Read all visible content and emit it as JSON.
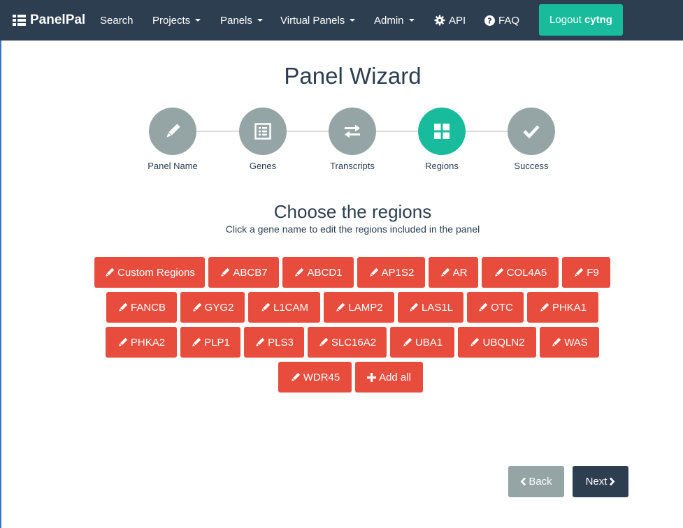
{
  "navbar": {
    "brand": "PanelPal",
    "items": [
      {
        "label": "Search",
        "dropdown": false
      },
      {
        "label": "Projects",
        "dropdown": true
      },
      {
        "label": "Panels",
        "dropdown": true
      },
      {
        "label": "Virtual Panels",
        "dropdown": true
      },
      {
        "label": "Admin",
        "dropdown": true
      },
      {
        "label": "API",
        "icon": "gear-icon"
      },
      {
        "label": "FAQ",
        "icon": "question-circle-icon"
      }
    ],
    "logout_label": "Logout",
    "username": "cytng"
  },
  "wizard": {
    "title": "Panel Wizard",
    "steps": [
      {
        "label": "Panel Name",
        "icon": "pencil-icon",
        "active": false
      },
      {
        "label": "Genes",
        "icon": "list-icon",
        "active": false
      },
      {
        "label": "Transcripts",
        "icon": "swap-arrows-icon",
        "active": false
      },
      {
        "label": "Regions",
        "icon": "grid-icon",
        "active": true
      },
      {
        "label": "Success",
        "icon": "checkmark-icon",
        "active": false
      }
    ]
  },
  "regions": {
    "heading": "Choose the regions",
    "instructions": "Click a gene name to edit the regions included in the panel",
    "buttons": [
      "Custom Regions",
      "ABCB7",
      "ABCD1",
      "AP1S2",
      "AR",
      "COL4A5",
      "F9",
      "FANCB",
      "GYG2",
      "L1CAM",
      "LAMP2",
      "LAS1L",
      "OTC",
      "PHKA1",
      "PHKA2",
      "PLP1",
      "PLS3",
      "SLC16A2",
      "UBA1",
      "UBQLN2",
      "WAS",
      "WDR45"
    ],
    "add_all_label": "Add all"
  },
  "footer": {
    "back_label": "Back",
    "next_label": "Next"
  },
  "colors": {
    "navbar": "#2c3e50",
    "accent": "#18bc9c",
    "region_button": "#e74c3c",
    "step_inactive": "#95a5a6"
  }
}
